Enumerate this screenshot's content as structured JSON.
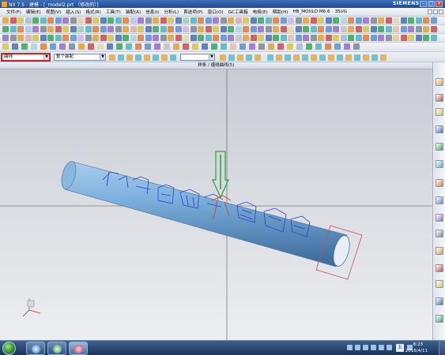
{
  "window": {
    "title": "NX 7.5 - 建模 - [_model2.prt （修改的）]",
    "brand": "SIEMENS",
    "buttons": [
      "–",
      "□",
      "×"
    ]
  },
  "menu": {
    "items": [
      "文件(F)",
      "编辑(E)",
      "视图(V)",
      "插入(S)",
      "格式(R)",
      "工具(T)",
      "装配(A)",
      "信息(I)",
      "分析(L)",
      "首选项(P)",
      "窗口(O)",
      "GC工具箱",
      "电极(E)",
      "帮助(H)",
      "HB_MOULD M6.6",
      "35UG"
    ]
  },
  "selection_bar": {
    "filter_value": "曲线",
    "scope_value": "整个装配",
    "extra_value": ""
  },
  "viewport": {
    "header": "样条 / 缠绕曲线(5)"
  },
  "colors": {
    "cylinder": "#6fa6d6",
    "curves": "#2f3fcf",
    "arrow": "#2aa23a",
    "sketch": "#d04a6a"
  },
  "taskbar": {
    "ime_label": "五",
    "time": "8:23",
    "date": "2016/4/11"
  }
}
